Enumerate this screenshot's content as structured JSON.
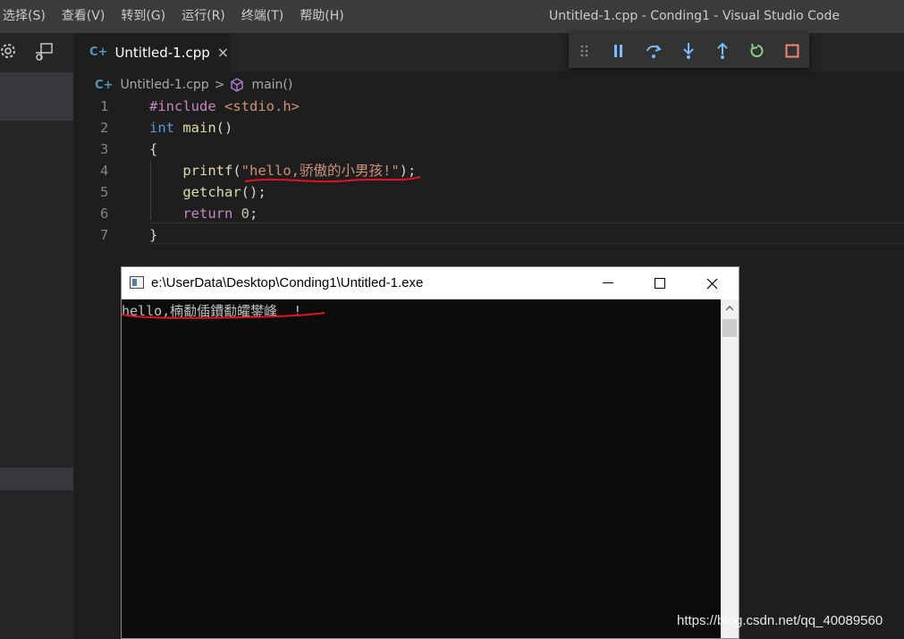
{
  "menu": {
    "items": [
      "选择(S)",
      "查看(V)",
      "转到(G)",
      "运行(R)",
      "终端(T)",
      "帮助(H)"
    ]
  },
  "window_title": "Untitled-1.cpp - Conding1 - Visual Studio Code",
  "sidebar": {
    "icons": [
      "gear-icon",
      "remote-explorer-icon"
    ]
  },
  "tab": {
    "icon_glyph": "C+",
    "label": "Untitled-1.cpp",
    "close_glyph": "×"
  },
  "debug_toolbar": {
    "buttons": [
      "drag-handle-icon",
      "pause-icon",
      "step-over-icon",
      "step-into-icon",
      "step-out-icon",
      "restart-icon",
      "stop-icon"
    ],
    "colors": {
      "pause": "#75beff",
      "step": "#75beff",
      "restart": "#89d185",
      "stop": "#f48771"
    }
  },
  "breadcrumb": {
    "file": "Untitled-1.cpp",
    "separator": ">",
    "symbol": "main()"
  },
  "editor": {
    "lines": [
      {
        "num": "1",
        "tokens": [
          {
            "t": "#include ",
            "c": "kw-purple"
          },
          {
            "t": "<stdio.h>",
            "c": "str"
          }
        ]
      },
      {
        "num": "2",
        "tokens": [
          {
            "t": "int",
            "c": "kw-blue"
          },
          {
            "t": " ",
            "c": "punc"
          },
          {
            "t": "main",
            "c": "fn"
          },
          {
            "t": "()",
            "c": "punc"
          }
        ]
      },
      {
        "num": "3",
        "tokens": [
          {
            "t": "{",
            "c": "punc"
          }
        ]
      },
      {
        "num": "4",
        "tokens": [
          {
            "t": "    ",
            "c": "punc"
          },
          {
            "t": "printf",
            "c": "fn"
          },
          {
            "t": "(",
            "c": "punc"
          },
          {
            "t": "\"hello,骄傲的小男孩!\"",
            "c": "str"
          },
          {
            "t": ");",
            "c": "punc"
          }
        ]
      },
      {
        "num": "5",
        "tokens": [
          {
            "t": "    ",
            "c": "punc"
          },
          {
            "t": "getchar",
            "c": "fn"
          },
          {
            "t": "();",
            "c": "punc"
          }
        ]
      },
      {
        "num": "6",
        "tokens": [
          {
            "t": "    ",
            "c": "punc"
          },
          {
            "t": "return",
            "c": "kw-purple"
          },
          {
            "t": " ",
            "c": "punc"
          },
          {
            "t": "0",
            "c": "num"
          },
          {
            "t": ";",
            "c": "punc"
          }
        ]
      },
      {
        "num": "7",
        "tokens": [
          {
            "t": "}",
            "c": "punc"
          }
        ]
      }
    ]
  },
  "console": {
    "title": "e:\\UserData\\Desktop\\Conding1\\Untitled-1.exe",
    "output": "hello,楠勫偛鐨勫皬鐢峰  !",
    "controls": [
      "minimize-icon",
      "maximize-icon",
      "close-icon"
    ]
  },
  "watermark": "https://blog.csdn.net/qq_40089560",
  "colors": {
    "annotation": "#e81123"
  }
}
